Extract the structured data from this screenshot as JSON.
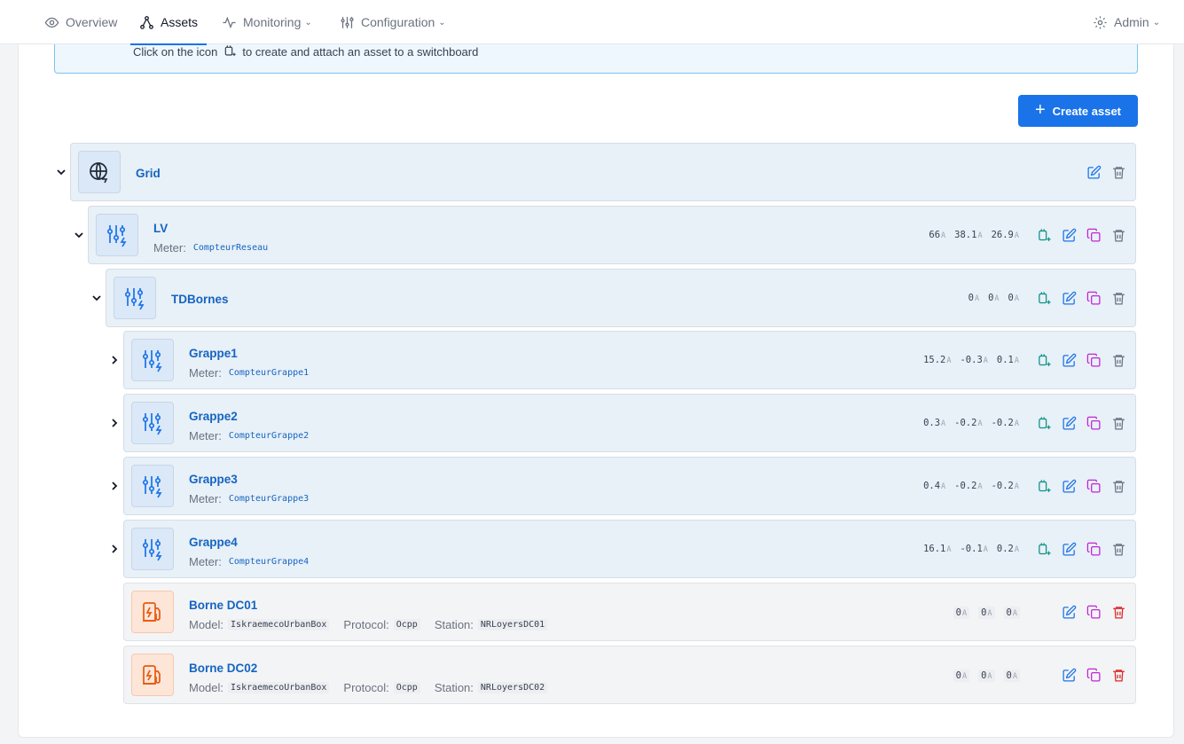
{
  "nav": {
    "items": [
      {
        "label": "Overview",
        "icon": "eye-icon"
      },
      {
        "label": "Assets",
        "icon": "network-icon"
      },
      {
        "label": "Monitoring",
        "icon": "activity-icon"
      },
      {
        "label": "Configuration",
        "icon": "sliders-icon"
      }
    ],
    "user_label": "Admin"
  },
  "info": {
    "text_before": "Click on the icon",
    "text_after": "to create and attach an asset to a switchboard"
  },
  "create_label": "Create asset",
  "meter_label": "Meter:",
  "model_label": "Model:",
  "protocol_label": "Protocol:",
  "station_label": "Station:",
  "unit": "A",
  "colors": {
    "primary": "#1a73e8",
    "link": "#1565c0",
    "teal_icon": "#0d9488",
    "duplicate_icon": "#c026d3",
    "danger_icon": "#dc2626",
    "charger_icon": "#ea580c"
  },
  "assets": [
    {
      "name": "Grid",
      "type": "grid"
    },
    {
      "name": "LV",
      "type": "switchboard",
      "meter": "CompteurReseau",
      "readings": [
        "66",
        "38.1",
        "26.9"
      ]
    },
    {
      "name": "TDBornes",
      "type": "switchboard",
      "readings": [
        "0",
        "0",
        "0"
      ]
    },
    {
      "name": "Grappe1",
      "type": "switchboard",
      "meter": "CompteurGrappe1",
      "readings": [
        "15.2",
        "-0.3",
        "0.1"
      ]
    },
    {
      "name": "Grappe2",
      "type": "switchboard",
      "meter": "CompteurGrappe2",
      "readings": [
        "0.3",
        "-0.2",
        "-0.2"
      ]
    },
    {
      "name": "Grappe3",
      "type": "switchboard",
      "meter": "CompteurGrappe3",
      "readings": [
        "0.4",
        "-0.2",
        "-0.2"
      ]
    },
    {
      "name": "Grappe4",
      "type": "switchboard",
      "meter": "CompteurGrappe4",
      "readings": [
        "16.1",
        "-0.1",
        "0.2"
      ]
    },
    {
      "name": "Borne DC01",
      "type": "charger",
      "model": "IskraemecoUrbanBox",
      "protocol": "Ocpp",
      "station": "NRLoyersDC01",
      "readings": [
        "0",
        "0",
        "0"
      ]
    },
    {
      "name": "Borne DC02",
      "type": "charger",
      "model": "IskraemecoUrbanBox",
      "protocol": "Ocpp",
      "station": "NRLoyersDC02",
      "readings": [
        "0",
        "0",
        "0"
      ]
    }
  ]
}
